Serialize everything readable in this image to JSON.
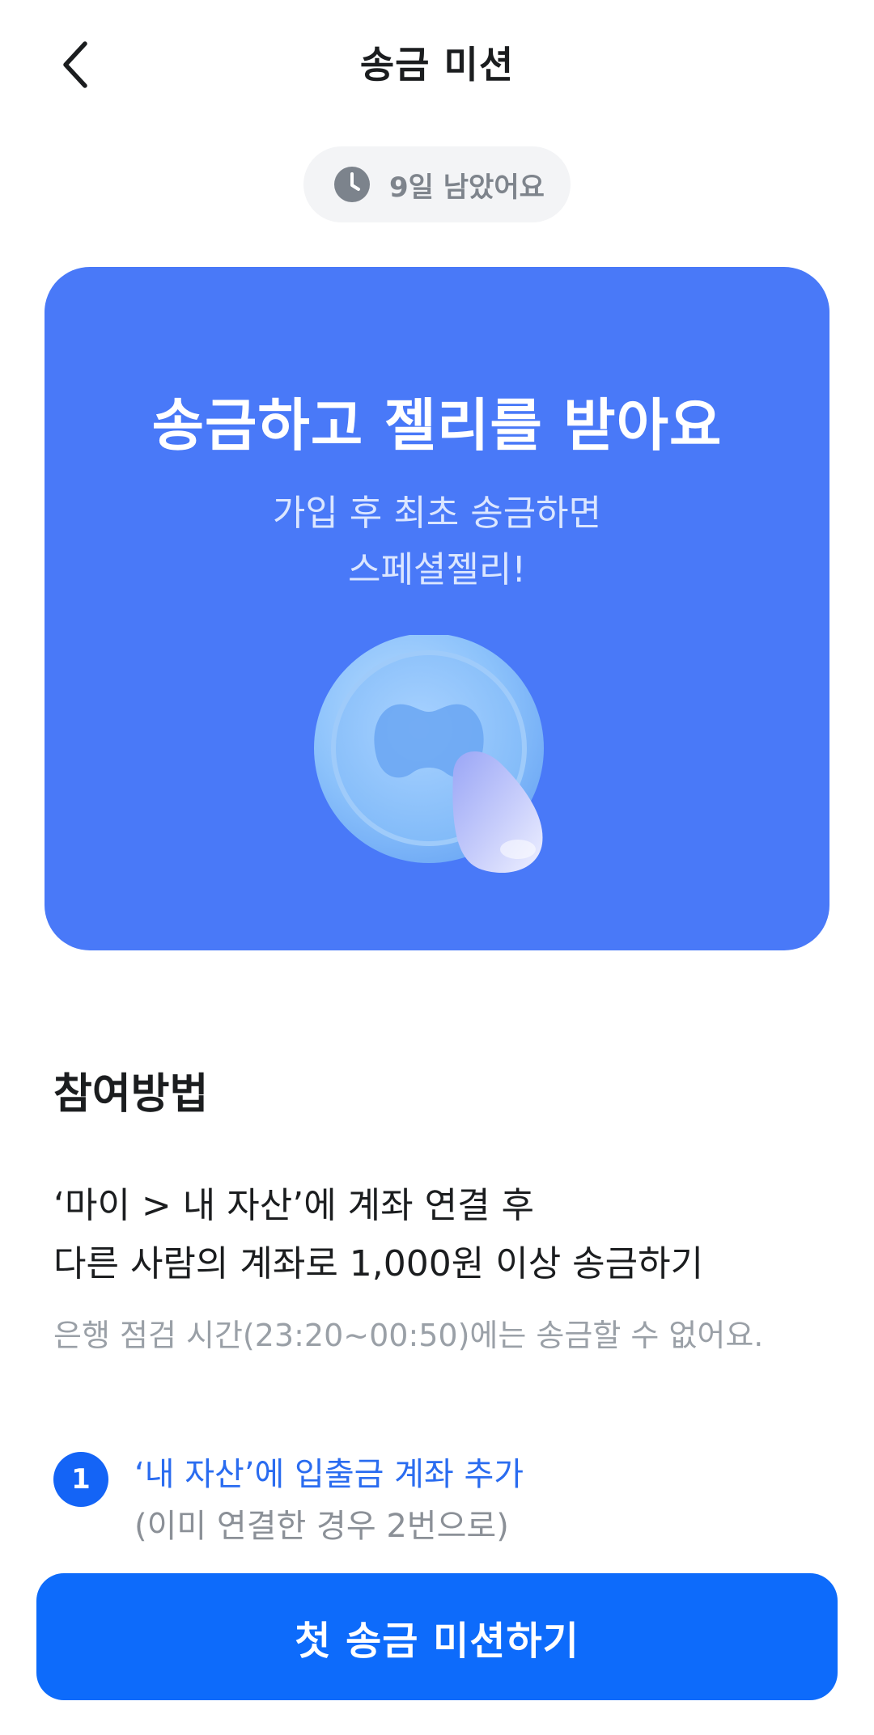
{
  "header": {
    "title": "송금 미션",
    "back_icon": "chevron-left-icon"
  },
  "timer": {
    "icon": "clock-icon",
    "text": "9일 남았어요"
  },
  "hero": {
    "title": "송금하고 젤리를 받아요",
    "subtitle_line1": "가입 후 최초 송금하면",
    "subtitle_line2": "스페셜젤리!",
    "background": "#4979f8"
  },
  "how_to": {
    "title": "참여방법",
    "desc_line1": "‘마이 > 내 자산’에 계좌 연결 후",
    "desc_line2": "다른 사람의 계좌로 1,000원 이상 송금하기",
    "note": "은행 점검 시간(23:20~00:50)에는 송금할 수 없어요."
  },
  "steps": [
    {
      "number": "1",
      "main": "‘내 자산’에 입출금 계좌 추가",
      "sub": "(이미 연결한 경우 2번으로)"
    }
  ],
  "cta": {
    "label": "첫 송금 미션하기",
    "color": "#0d6bfb"
  }
}
